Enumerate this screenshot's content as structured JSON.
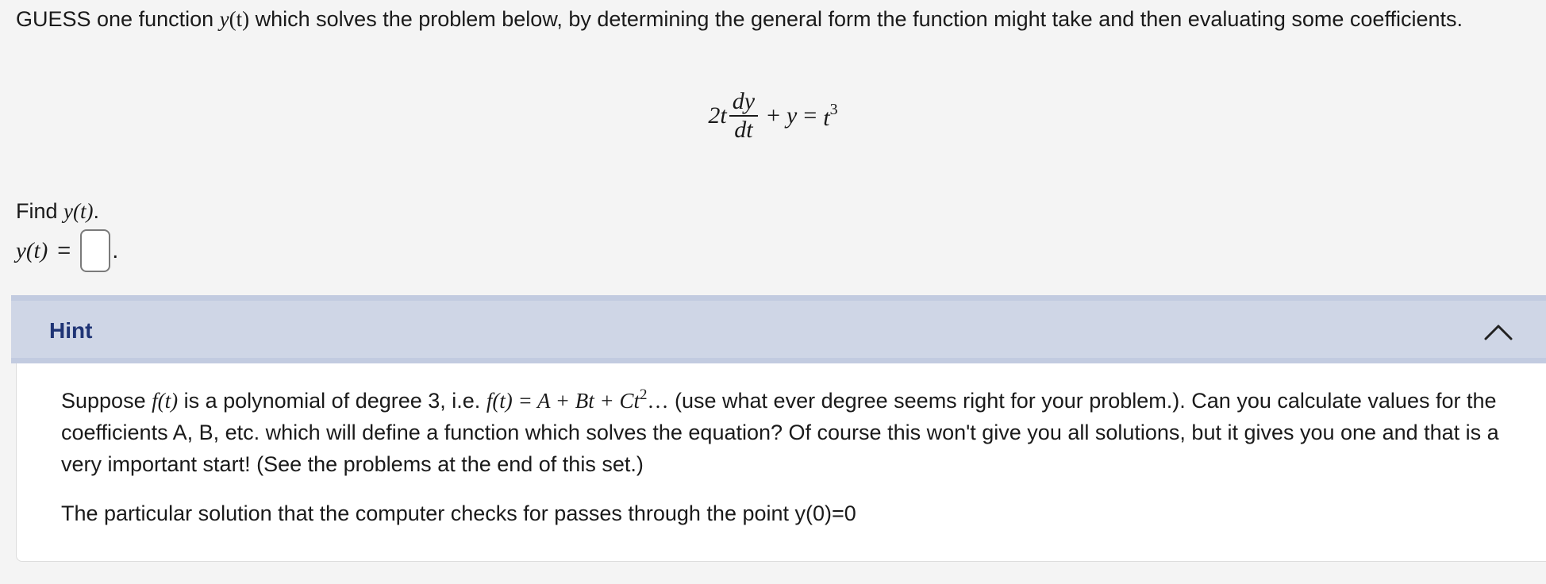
{
  "intro": {
    "text_before": "GUESS one function ",
    "math_y": "y",
    "math_paren_t": "(t)",
    "text_after": " which solves the problem below, by determining the general form the function might take and then evaluating some coefficients."
  },
  "equation": {
    "coefficient": "2t",
    "numerator": "dy",
    "denominator": "dt",
    "plus": "+",
    "y": "y",
    "equals": "=",
    "rhs_base": "t",
    "rhs_exp": "3"
  },
  "find": {
    "label": "Find ",
    "math": "y(t)",
    "period": "."
  },
  "answer": {
    "lhs": "y(t)",
    "equals": "=",
    "value": "",
    "period": "."
  },
  "hint": {
    "title": "Hint",
    "toggle_icon": "chevron-up-icon",
    "para1_a": "Suppose ",
    "para1_ft": "f(t)",
    "para1_b": " is a polynomial of degree 3, i.e. ",
    "para1_ft2": "f(t)",
    "para1_eq": " = A + Bt + Ct",
    "para1_exp": "2",
    "para1_dots": "…",
    "para1_c": " (use what ever degree seems right for your problem.). Can you calculate values for the coefficients A, B, etc. which will define a function which solves the equation? Of course this won't give you all solutions, but it gives you one and that is a very important start! (See the problems at the end of this set.)",
    "para2": "The particular solution that the computer checks for passes through the point y(0)=0"
  },
  "colors": {
    "hint_header_bg": "#cfd6e6",
    "hint_title": "#1f3475",
    "page_bg": "#f4f4f4"
  }
}
